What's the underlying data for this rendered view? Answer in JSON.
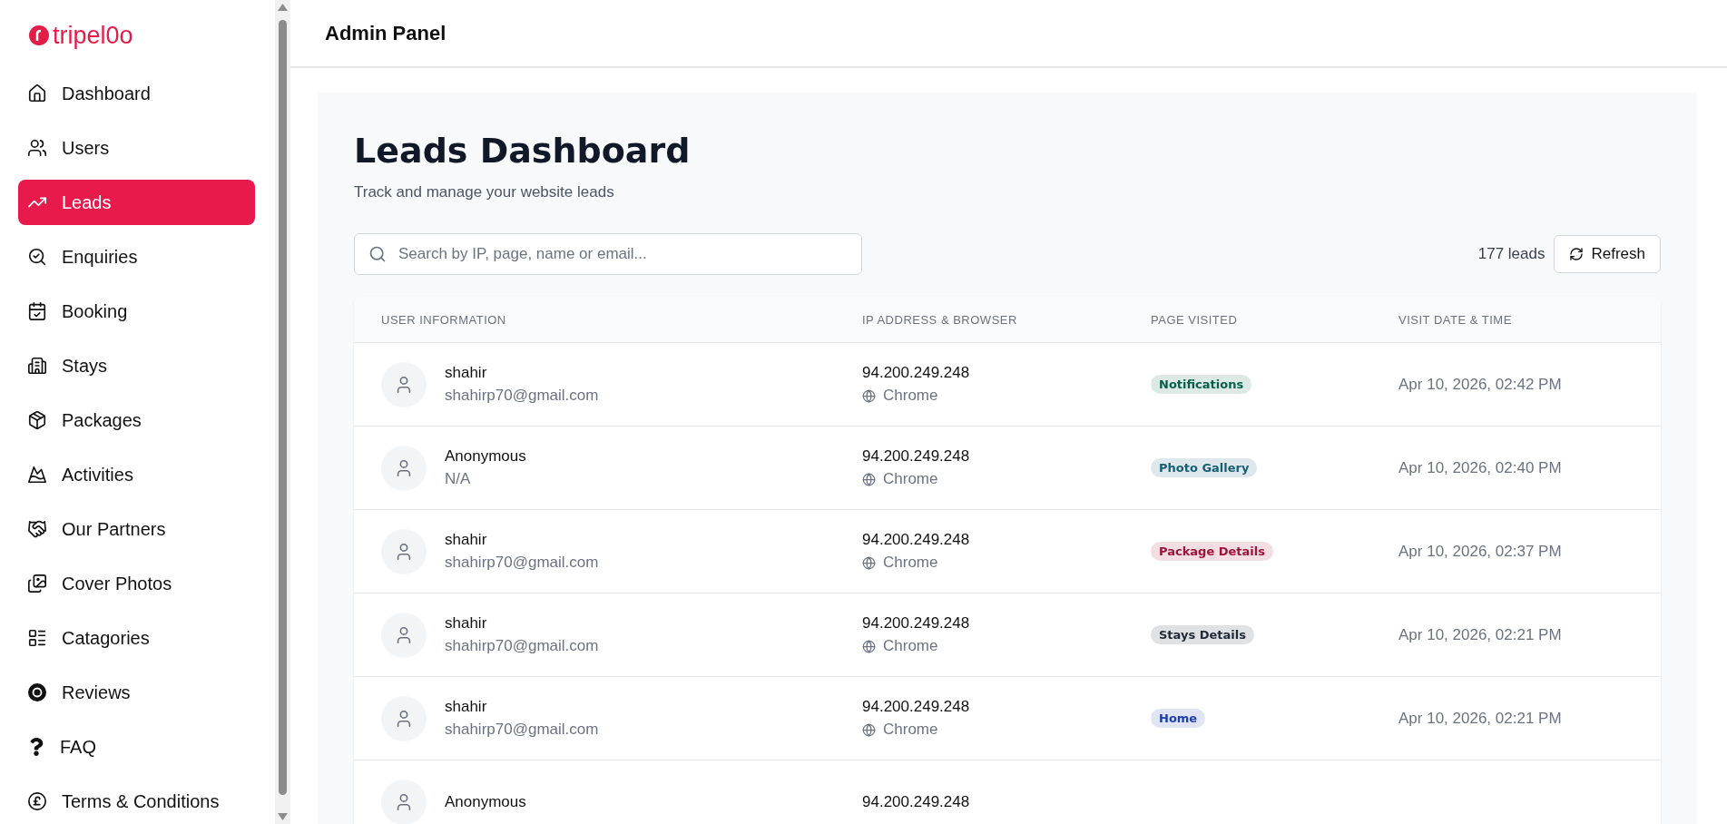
{
  "sidebar": {
    "logo": "tripel0o",
    "items": [
      {
        "label": "Dashboard",
        "selected": false
      },
      {
        "label": "Users",
        "selected": false
      },
      {
        "label": "Leads",
        "selected": true
      },
      {
        "label": "Enquiries",
        "selected": false
      },
      {
        "label": "Booking",
        "selected": false
      },
      {
        "label": "Stays",
        "selected": false
      },
      {
        "label": "Packages",
        "selected": false
      },
      {
        "label": "Activities",
        "selected": false
      },
      {
        "label": "Our Partners",
        "selected": false
      },
      {
        "label": "Cover Photos",
        "selected": false
      },
      {
        "label": "Catagories",
        "selected": false
      },
      {
        "label": "Reviews",
        "selected": false
      },
      {
        "label": "FAQ",
        "selected": false
      },
      {
        "label": "Terms & Conditions",
        "selected": false
      }
    ]
  },
  "header": {
    "title": "Admin Panel"
  },
  "page": {
    "title": "Leads Dashboard",
    "subtitle": "Track and manage your website leads"
  },
  "search": {
    "placeholder": "Search by IP, page, name or email..."
  },
  "count": "177 leads",
  "refresh_button": "Refresh",
  "table": {
    "columns": [
      "USER INFORMATION",
      "IP ADDRESS & BROWSER",
      "PAGE VISITED",
      "VISIT DATE & TIME"
    ],
    "rows": [
      {
        "name": "shahir",
        "email": "shahirp70@gmail.com",
        "ip": "94.200.249.248",
        "browser": "Chrome",
        "page": "Notifications",
        "color": "#065f46",
        "time": "Apr 10, 2026, 02:42 PM"
      },
      {
        "name": "Anonymous",
        "email": "N/A",
        "ip": "94.200.249.248",
        "browser": "Chrome",
        "page": "Photo Gallery",
        "color": "#155e75",
        "time": "Apr 10, 2026, 02:40 PM"
      },
      {
        "name": "shahir",
        "email": "shahirp70@gmail.com",
        "ip": "94.200.249.248",
        "browser": "Chrome",
        "page": "Package Details",
        "color": "#9f1239",
        "time": "Apr 10, 2026, 02:37 PM"
      },
      {
        "name": "shahir",
        "email": "shahirp70@gmail.com",
        "ip": "94.200.249.248",
        "browser": "Chrome",
        "page": "Stays Details",
        "color": "#1f2937",
        "time": "Apr 10, 2026, 02:21 PM"
      },
      {
        "name": "shahir",
        "email": "shahirp70@gmail.com",
        "ip": "94.200.249.248",
        "browser": "Chrome",
        "page": "Home",
        "color": "#1e40af",
        "time": "Apr 10, 2026, 02:21 PM"
      },
      {
        "name": "Anonymous",
        "ip": "94.200.249.248"
      }
    ]
  }
}
